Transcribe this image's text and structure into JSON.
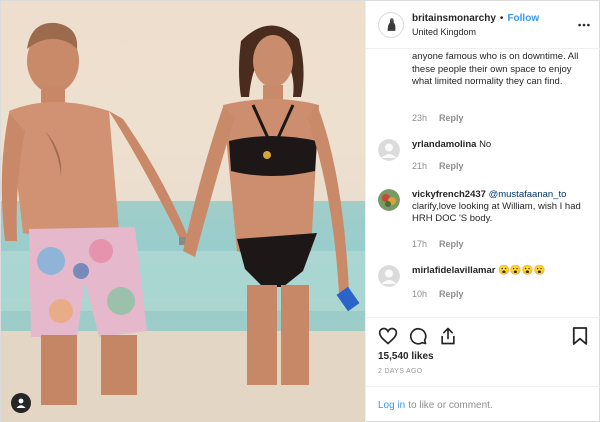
{
  "post": {
    "username": "britainsmonarchy",
    "separator": "•",
    "follow_label": "Follow",
    "location": "United Kingdom"
  },
  "comments": [
    {
      "text": "anyone famous who is on downtime. All these people their own space to enjoy what limited normality they can find.",
      "time": "23h",
      "reply": "Reply"
    },
    {
      "user": "yrlandamolina",
      "text": "No",
      "time": "21h",
      "reply": "Reply"
    },
    {
      "user": "vickyfrench2437",
      "mention": "@mustafaanan_to",
      "text": "clarify,love looking at William, wish I had HRH DOC 'S body.",
      "time": "17h",
      "reply": "Reply"
    },
    {
      "user": "mirlafidelavillamar",
      "text": "😮😮😮😮",
      "time": "10h",
      "reply": "Reply"
    }
  ],
  "stats": {
    "likes": "15,540 likes",
    "posted": "2 DAYS AGO"
  },
  "login": {
    "link": "Log in",
    "text": "to like or comment."
  },
  "icons": {
    "like": "heart-icon",
    "comment": "comment-icon",
    "share": "share-icon",
    "save": "bookmark-icon",
    "more": "more-icon",
    "tag": "user-tag-icon"
  },
  "colors": {
    "accent": "#3897f0",
    "text": "#262626",
    "muted": "#8e8e8e",
    "border": "#efefef"
  }
}
